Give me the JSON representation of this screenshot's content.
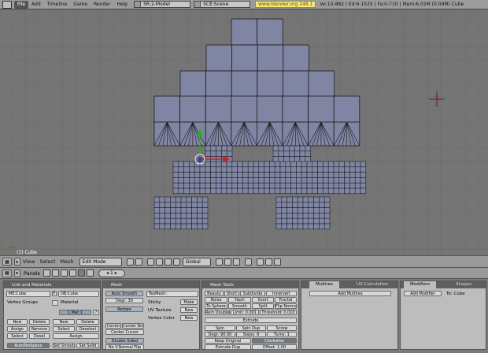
{
  "top": {
    "menus": [
      "File",
      "Add",
      "Timeline",
      "Game",
      "Render",
      "Help"
    ],
    "screen": "SR:2-Model",
    "scene": "SCE:Scene",
    "url": "www.blender.org 248.1",
    "stats": "Ve:10-882 | Ed:6-1525 | Fa:0-710 | Mem:6.02M (0.09M) Cube"
  },
  "viewport": {
    "object_label": "(1) Cube",
    "colors": {
      "bg": "#757575",
      "grid": "#6c6c6c",
      "face": "#7f85a3",
      "wire": "#1c1c1c"
    }
  },
  "view_header": {
    "menus": [
      "View",
      "Select",
      "Mesh"
    ],
    "mode": "Edit Mode",
    "orientation": "Global"
  },
  "buttons_header": {
    "panels_label": "Panels",
    "page": "1"
  },
  "panels": {
    "link": {
      "title": "Link and Materials",
      "me": "ME:Cube",
      "f": "F",
      "ob": "OB:Cube",
      "vertex_groups": "Vertex Groups",
      "material_label": "Material",
      "mat_index": "1 Mat 1",
      "q": "?",
      "new": "New",
      "delete": "Delete",
      "assign": "Assign",
      "remove": "Remove",
      "select": "Select",
      "deselect": "Deselect",
      "desel": "Desel",
      "new2": "New",
      "delete2": "Delete",
      "select2": "Select",
      "deselect2": "Deselect",
      "assign2": "Assign",
      "autotex": "AutoTexSpace",
      "set_smooth": "Set Smooth",
      "set_solid": "Set Solid"
    },
    "mesh": {
      "title": "Mesh",
      "auto_smooth": "Auto Smooth",
      "degr": "Degr: 30",
      "retopo": "Retopo",
      "texmesh": "TexMesh:",
      "sticky": "Sticky",
      "uv_texture": "UV Texture",
      "vertex_color": "Vertex Color",
      "make": "Make",
      "new1": "New",
      "new2": "New",
      "center": "Center",
      "center_new": "Center New",
      "center_cursor": "Center Cursor",
      "double_sided": "Double Sided",
      "no_v_normal_flip": "No V.Normal Flip"
    },
    "tools": {
      "title": "Mesh Tools",
      "row1": [
        "Beauty",
        "Short",
        "Subdivide",
        "Innervert"
      ],
      "row2": [
        "Noise",
        "Hash",
        "Xsort",
        "Fractal"
      ],
      "row3": [
        "To Sphere",
        "Smooth",
        "Split",
        "Flip Normals"
      ],
      "rem_double": "Rem Double",
      "limit": "Limit: 0.001",
      "threshold": "Threshold: 0.010",
      "extrude": "Extrude",
      "spin": "Spin",
      "spin_dup": "Spin Dup",
      "screw": "Screw",
      "degr": "Degr: 90.00",
      "steps": "Steps: 9",
      "turns": "Turns: 1",
      "keep_original": "Keep Original",
      "clockwise": "Clockwise",
      "extrude_dup": "Extrude Dup",
      "offset": "Offset: 1.00"
    },
    "multires": {
      "title": "Multires",
      "tab2": "UV Calculation",
      "add": "Add Multires"
    },
    "modifiers": {
      "title": "Modifiers",
      "tab2": "Shapes",
      "add": "Add Modifier",
      "to": "To: Cube"
    }
  }
}
